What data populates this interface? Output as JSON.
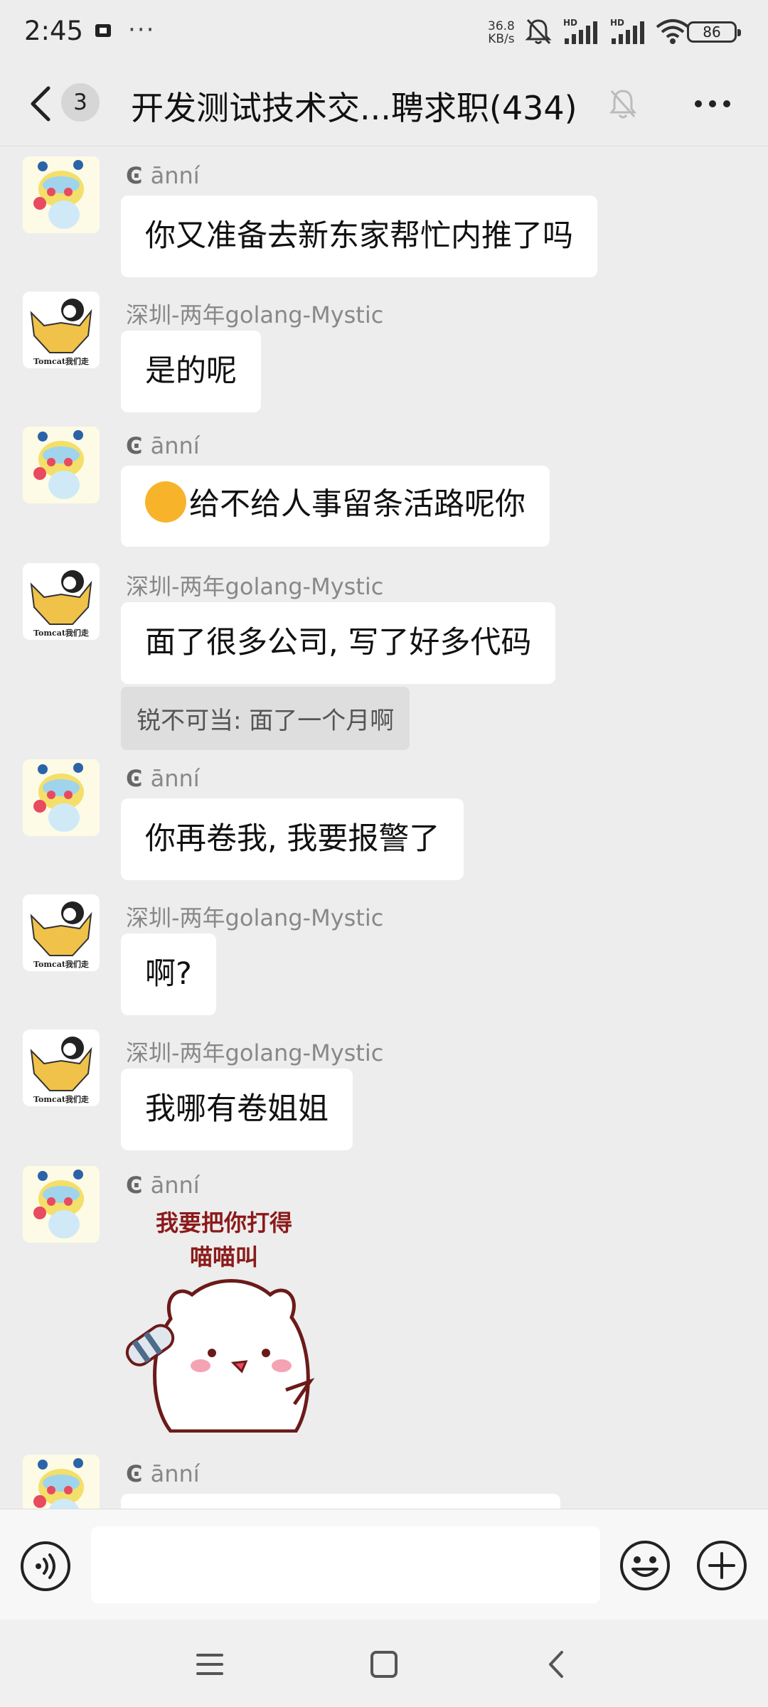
{
  "status_bar": {
    "time": "2:45",
    "more": "···",
    "speed_value": "36.8",
    "speed_unit": "KB/s",
    "hd": "HD",
    "battery": "86"
  },
  "header": {
    "unread_count": "3",
    "title": "开发测试技术交...聘求职(434)"
  },
  "messages": [
    {
      "sender": "ānní",
      "text": "你又准备去新东家帮忙内推了吗"
    },
    {
      "sender": "深圳-两年golang-Mystic",
      "text": "是的呢"
    },
    {
      "sender": "ānní",
      "text": "给不给人事留条活路呢你"
    },
    {
      "sender": "深圳-两年golang-Mystic",
      "text": "面了很多公司, 写了好多代码",
      "quote": "锐不可当: 面了一个月啊"
    },
    {
      "sender": "ānní",
      "text": "你再卷我, 我要报警了"
    },
    {
      "sender": "深圳-两年golang-Mystic",
      "text": "啊?"
    },
    {
      "sender": "深圳-两年golang-Mystic",
      "text": "我哪有卷姐姐"
    },
    {
      "sender": "ānní",
      "sticker_line1": "我要把你打得",
      "sticker_line2": "喵喵叫"
    },
    {
      "sender": "ānní"
    }
  ],
  "avatars": {
    "tomcat_caption": "Tomcat我们走"
  },
  "input": {
    "placeholder": ""
  },
  "colors": {
    "background": "#ededed",
    "bubble": "#ffffff",
    "quote_bg": "#dedede",
    "sticker_text": "#8b1a1a"
  },
  "icons": [
    "back-icon",
    "bell-off-icon",
    "more-icon",
    "voice-icon",
    "emoji-icon",
    "plus-icon",
    "menu-icon",
    "home-icon",
    "nav-back-icon"
  ]
}
